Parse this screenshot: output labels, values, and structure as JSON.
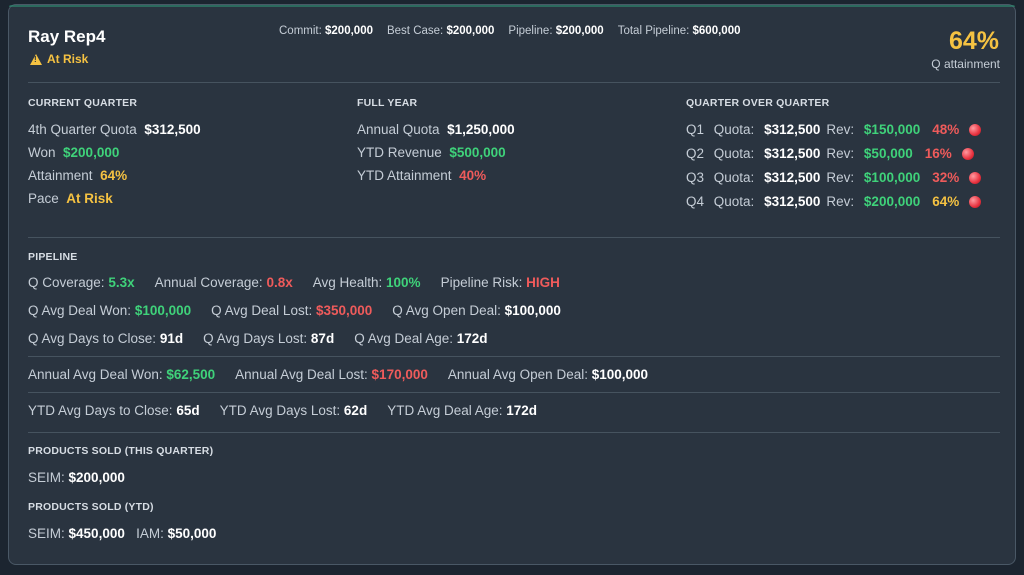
{
  "rep": {
    "name": "Ray Rep4",
    "status": "At Risk"
  },
  "summary": {
    "commit_label": "Commit:",
    "commit": "$200,000",
    "best_label": "Best Case:",
    "best": "$200,000",
    "pipeline_label": "Pipeline:",
    "pipeline": "$200,000",
    "total_label": "Total Pipeline:",
    "total": "$600,000"
  },
  "attainment": {
    "value": "64%",
    "label": "Q attainment"
  },
  "current_quarter": {
    "title": "CURRENT QUARTER",
    "quota_label": "4th Quarter Quota",
    "quota": "$312,500",
    "won_label": "Won",
    "won": "$200,000",
    "attain_label": "Attainment",
    "attain": "64%",
    "pace_label": "Pace",
    "pace": "At Risk"
  },
  "full_year": {
    "title": "FULL YEAR",
    "quota_label": "Annual Quota",
    "quota": "$1,250,000",
    "rev_label": "YTD Revenue",
    "rev": "$500,000",
    "attain_label": "YTD Attainment",
    "attain": "40%"
  },
  "qoq": {
    "title": "QUARTER OVER QUARTER",
    "quota_label": "Quota:",
    "rev_label": "Rev:",
    "rows": [
      {
        "q": "Q1",
        "quota": "$312,500",
        "rev": "$150,000",
        "pct": "48%",
        "pct_color": "red"
      },
      {
        "q": "Q2",
        "quota": "$312,500",
        "rev": "$50,000",
        "pct": "16%",
        "pct_color": "red"
      },
      {
        "q": "Q3",
        "quota": "$312,500",
        "rev": "$100,000",
        "pct": "32%",
        "pct_color": "red"
      },
      {
        "q": "Q4",
        "quota": "$312,500",
        "rev": "$200,000",
        "pct": "64%",
        "pct_color": "yellow"
      }
    ]
  },
  "pipeline": {
    "title": "PIPELINE",
    "q_coverage_label": "Q Coverage:",
    "q_coverage": "5.3x",
    "annual_coverage_label": "Annual Coverage:",
    "annual_coverage": "0.8x",
    "avg_health_label": "Avg Health:",
    "avg_health": "100%",
    "risk_label": "Pipeline Risk:",
    "risk": "HIGH",
    "q_won_label": "Q Avg Deal Won:",
    "q_won": "$100,000",
    "q_lost_label": "Q Avg Deal Lost:",
    "q_lost": "$350,000",
    "q_open_label": "Q Avg Open Deal:",
    "q_open": "$100,000",
    "q_close_label": "Q Avg Days to Close:",
    "q_close": "91d",
    "q_days_lost_label": "Q Avg Days Lost:",
    "q_days_lost": "87d",
    "q_age_label": "Q Avg Deal Age:",
    "q_age": "172d",
    "a_won_label": "Annual Avg Deal Won:",
    "a_won": "$62,500",
    "a_lost_label": "Annual Avg Deal Lost:",
    "a_lost": "$170,000",
    "a_open_label": "Annual Avg Open Deal:",
    "a_open": "$100,000",
    "y_close_label": "YTD Avg Days to Close:",
    "y_close": "65d",
    "y_lost_label": "YTD Avg Days Lost:",
    "y_lost": "62d",
    "y_age_label": "YTD Avg Deal Age:",
    "y_age": "172d"
  },
  "products_q": {
    "title": "PRODUCTS SOLD (THIS QUARTER)",
    "seim_label": "SEIM:",
    "seim": "$200,000"
  },
  "products_ytd": {
    "title": "PRODUCTS SOLD (YTD)",
    "seim_label": "SEIM:",
    "seim": "$450,000",
    "iam_label": "IAM:",
    "iam": "$50,000"
  }
}
